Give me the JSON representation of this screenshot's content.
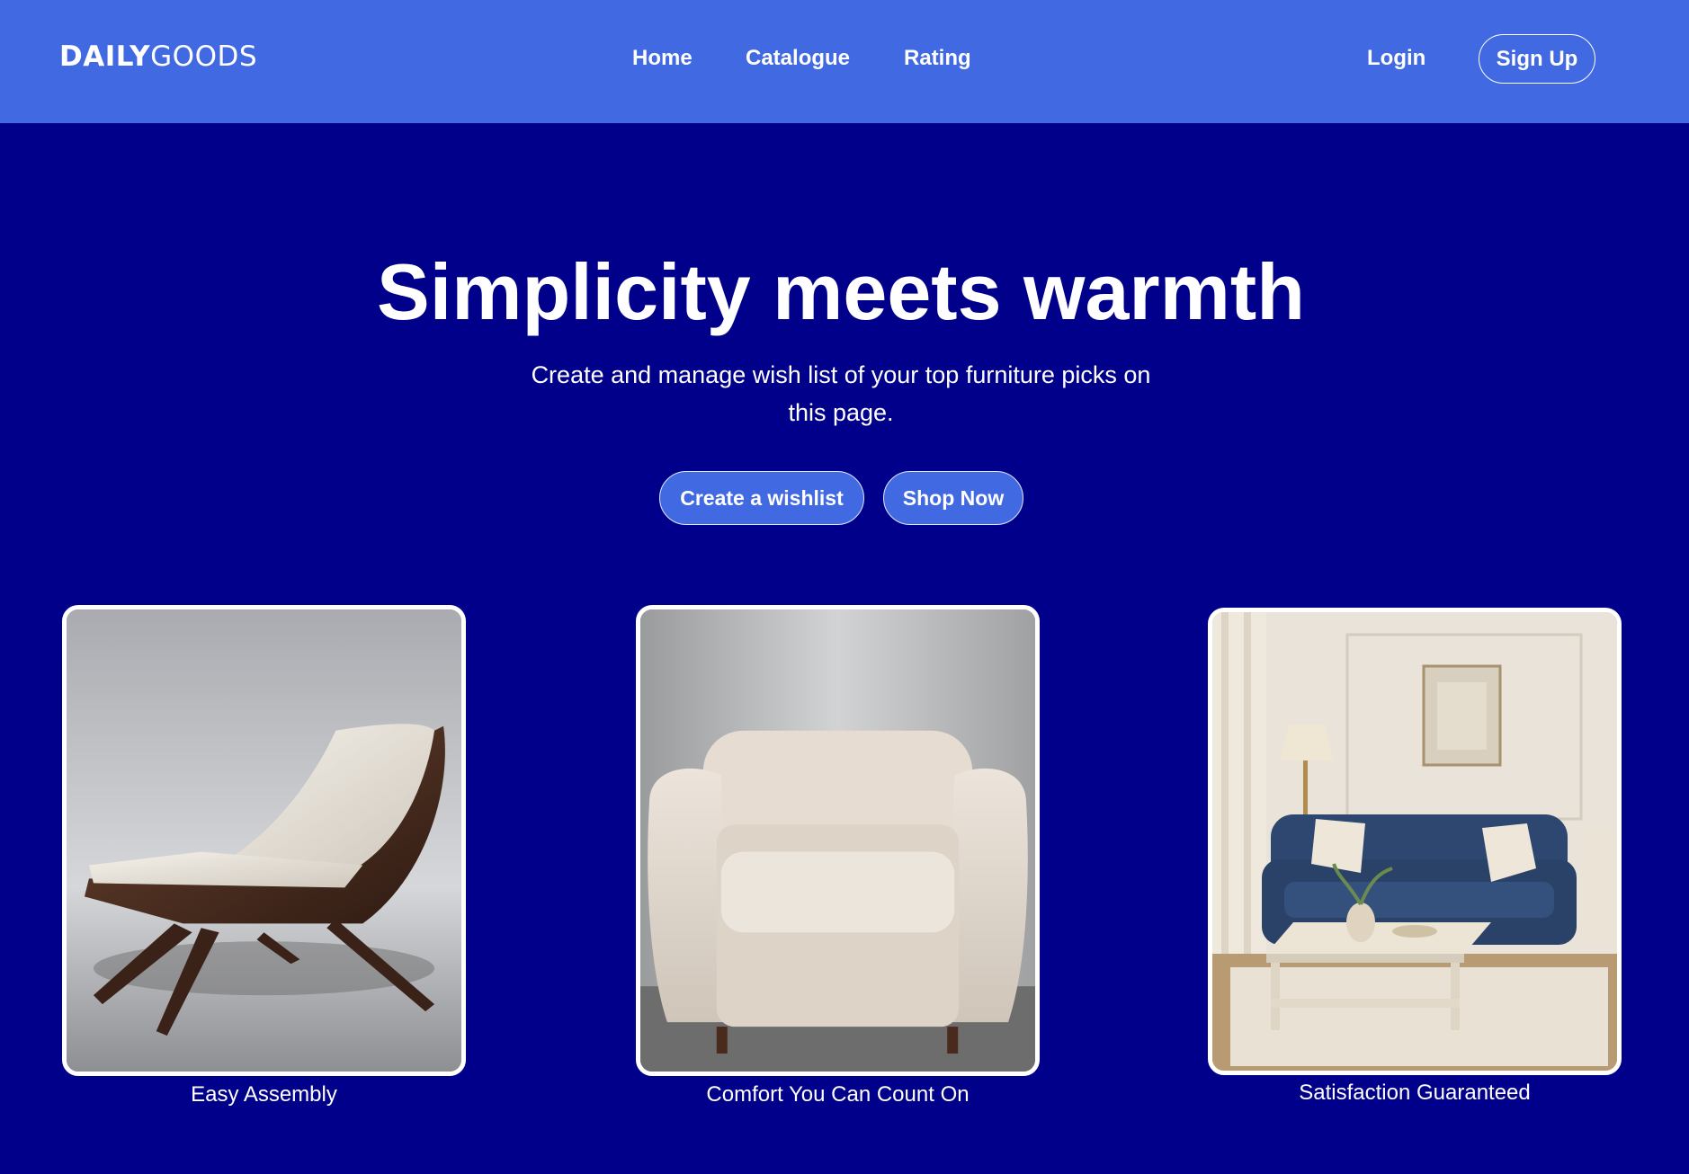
{
  "header": {
    "logo_bold": "DAILY",
    "logo_light": "GOODS",
    "nav": {
      "home": "Home",
      "catalogue": "Catalogue",
      "rating": "Rating"
    },
    "login": "Login",
    "signup": "Sign Up"
  },
  "hero": {
    "title": "Simplicity meets warmth",
    "subtitle": "Create and manage wish list of your top furniture picks on this page.",
    "create_wishlist": "Create a wishlist",
    "shop_now": "Shop Now"
  },
  "cards": [
    {
      "caption": "Easy Assembly",
      "image": "lounge-chair-photo"
    },
    {
      "caption": "Comfort You Can Count On",
      "image": "armchair-photo"
    },
    {
      "caption": "Satisfaction Guaranteed",
      "image": "living-room-photo"
    }
  ],
  "colors": {
    "header_bg": "#4169e1",
    "page_bg": "#00008b",
    "button_bg": "#4169e1",
    "text": "#ffffff"
  }
}
